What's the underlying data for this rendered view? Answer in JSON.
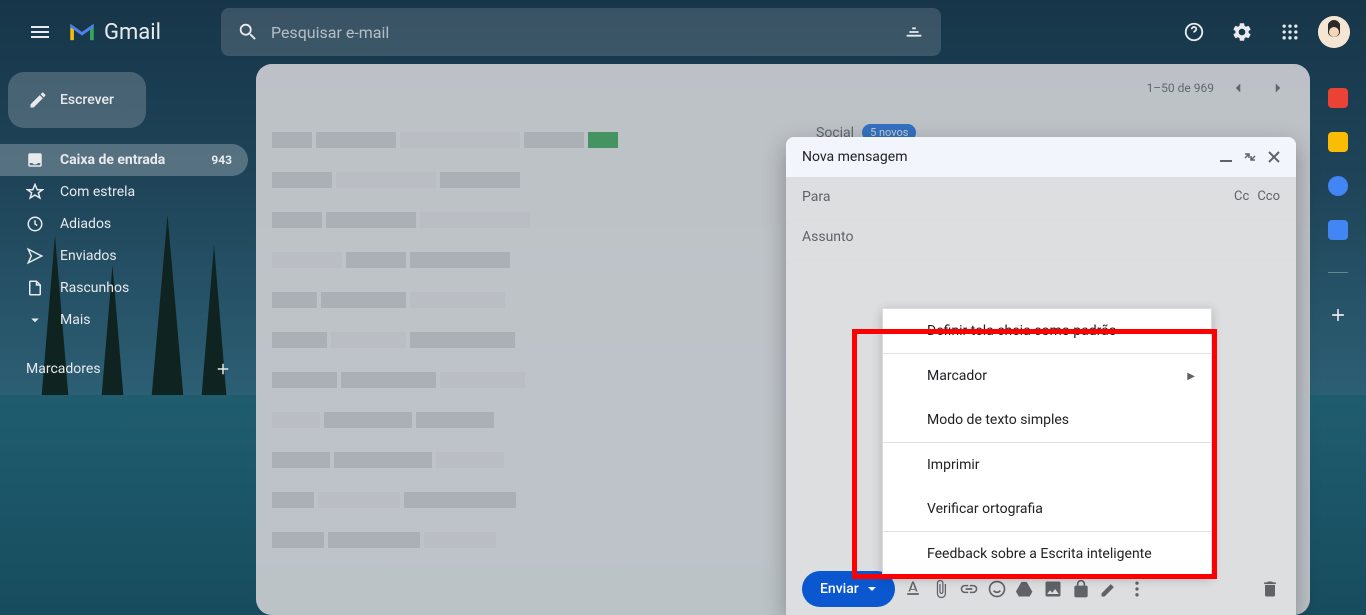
{
  "header": {
    "logo_text": "Gmail",
    "search_placeholder": "Pesquisar e-mail"
  },
  "sidebar": {
    "compose_label": "Escrever",
    "items": [
      {
        "label": "Caixa de entrada",
        "count": "943",
        "icon": "inbox"
      },
      {
        "label": "Com estrela",
        "count": "",
        "icon": "star"
      },
      {
        "label": "Adiados",
        "count": "",
        "icon": "clock"
      },
      {
        "label": "Enviados",
        "count": "",
        "icon": "send"
      },
      {
        "label": "Rascunhos",
        "count": "",
        "icon": "draft"
      },
      {
        "label": "Mais",
        "count": "",
        "icon": "more"
      }
    ],
    "labels_header": "Marcadores"
  },
  "toolbar": {
    "pagination": "1–50 de 969"
  },
  "tabs": {
    "social": "Social",
    "social_badge": "5 novos"
  },
  "compose": {
    "title": "Nova mensagem",
    "to_label": "Para",
    "cc_label": "Cc",
    "bcc_label": "Cco",
    "subject_label": "Assunto",
    "send_label": "Enviar"
  },
  "menu": {
    "items": [
      "Definir tela cheia como padrão",
      "Marcador",
      "Modo de texto simples",
      "Imprimir",
      "Verificar ortografia",
      "Feedback sobre a Escrita inteligente"
    ]
  }
}
